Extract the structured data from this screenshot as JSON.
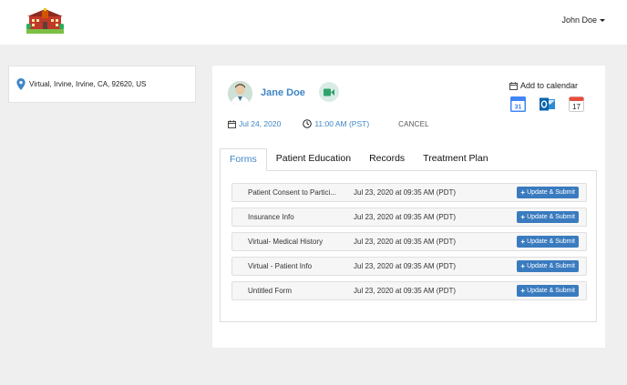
{
  "header": {
    "user_name": "John Doe"
  },
  "location": {
    "address": "Virtual, Irvine, Irvine, CA, 92620, US"
  },
  "appointment": {
    "patient_name": "Jane Doe",
    "date": "Jul 24, 2020",
    "time": "11:00 AM (PST)",
    "cancel_label": "CANCEL",
    "add_to_calendar_label": "Add to calendar",
    "calendar_day_google": "31",
    "calendar_day_apple": "17"
  },
  "tabs": [
    {
      "label": "Forms",
      "active": true
    },
    {
      "label": "Patient Education",
      "active": false
    },
    {
      "label": "Records",
      "active": false
    },
    {
      "label": "Treatment Plan",
      "active": false
    }
  ],
  "forms": [
    {
      "name": "Patient Consent to Partici...",
      "date": "Jul 23, 2020 at 09:35 AM (PDT)",
      "action": "Update & Submit"
    },
    {
      "name": "Insurance Info",
      "date": "Jul 23, 2020 at 09:35 AM (PDT)",
      "action": "Update & Submit"
    },
    {
      "name": "Virtual- Medical History",
      "date": "Jul 23, 2020 at 09:35 AM (PDT)",
      "action": "Update & Submit"
    },
    {
      "name": "Virtual - Patient Info",
      "date": "Jul 23, 2020 at 09:35 AM (PDT)",
      "action": "Update & Submit"
    },
    {
      "name": "Untitled Form",
      "date": "Jul 23, 2020 at 09:35 AM (PDT)",
      "action": "Update & Submit"
    }
  ],
  "icons": {
    "logo": "school-building-logo",
    "location": "map-pin-icon",
    "video": "video-camera-icon",
    "calendar": "calendar-icon",
    "clock": "clock-icon",
    "google_calendar": "google-calendar-icon",
    "outlook": "outlook-icon",
    "apple_calendar": "apple-calendar-icon"
  },
  "colors": {
    "accent": "#3f86c6",
    "button": "#3a7bbf",
    "video_green": "#2fa36b",
    "page_bg": "#efefef"
  }
}
